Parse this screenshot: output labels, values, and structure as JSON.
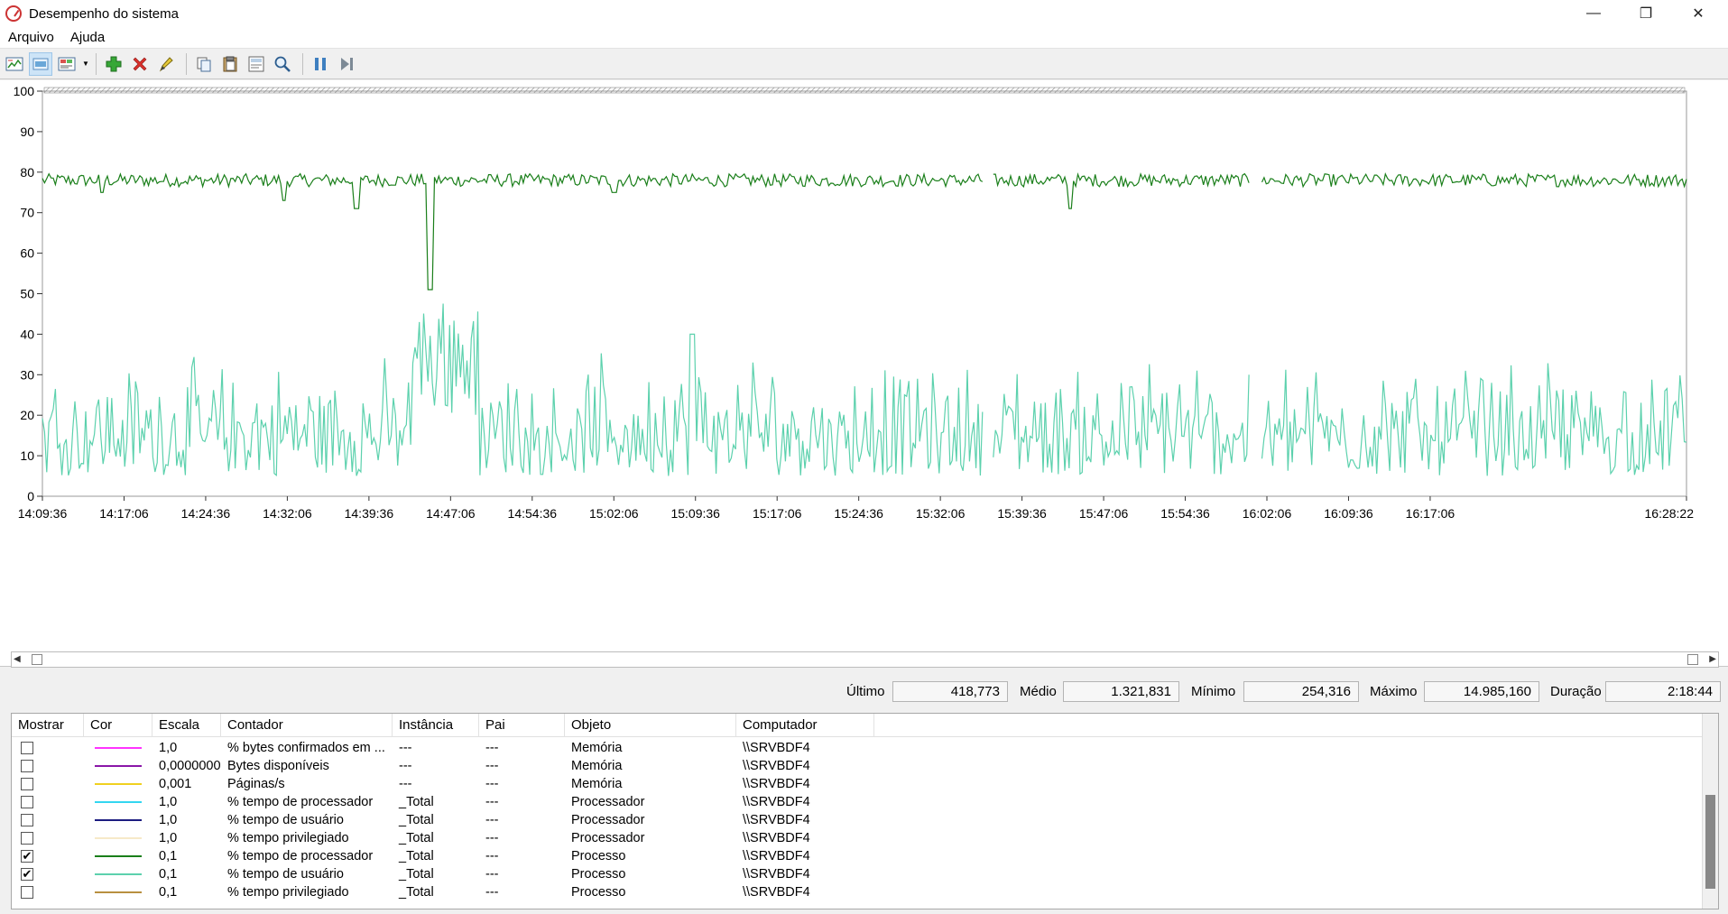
{
  "window": {
    "title": "Desempenho do sistema"
  },
  "title_buttons": {
    "minimize": "—",
    "restore": "❐",
    "close": "✕"
  },
  "menu": [
    "Arquivo",
    "Ajuda"
  ],
  "toolbar_icons": [
    "change-graph-icon",
    "highlight-icon",
    "properties-icon",
    "dropdown-icon",
    "add-counter-icon",
    "delete-counter-icon",
    "highlight-pen-icon",
    "copy-icon",
    "paste-icon",
    "properties-page-icon",
    "zoom-icon",
    "freeze-icon",
    "update-icon"
  ],
  "chart_data": {
    "type": "line",
    "ylim": [
      0,
      100
    ],
    "yticks": [
      0,
      10,
      20,
      30,
      40,
      50,
      60,
      70,
      80,
      90,
      100
    ],
    "x_tick_labels": [
      "14:09:36",
      "14:17:06",
      "14:24:36",
      "14:32:06",
      "14:39:36",
      "14:47:06",
      "14:54:36",
      "15:02:06",
      "15:09:36",
      "15:17:06",
      "15:24:36",
      "15:32:06",
      "15:39:36",
      "15:47:06",
      "15:54:36",
      "16:02:06",
      "16:09:36",
      "16:17:06",
      "16:28:22"
    ],
    "series": [
      {
        "name": "% tempo de processador",
        "color": "#1a7f1a",
        "baseline": 78,
        "amplitude": 1.6,
        "gaps": [
          0.572,
          0.578,
          0.735,
          0.741
        ],
        "dips": [
          [
            0.036,
            75
          ],
          [
            0.147,
            73
          ],
          [
            0.191,
            71
          ],
          [
            0.236,
            51
          ],
          [
            0.347,
            51
          ],
          [
            0.348,
            75
          ],
          [
            0.625,
            71
          ]
        ]
      },
      {
        "name": "% tempo de usuário",
        "color": "#5cd1ad",
        "typical_range": [
          5,
          36
        ],
        "peak_region": [
          0.225,
          0.265
        ],
        "peak_max": 49,
        "secondary_peak": [
          0.395,
          40
        ]
      }
    ]
  },
  "stats": [
    {
      "label": "Último",
      "value": "418,773"
    },
    {
      "label": "Médio",
      "value": "1.321,831"
    },
    {
      "label": "Mínimo",
      "value": "254,316"
    },
    {
      "label": "Máximo",
      "value": "14.985,160"
    },
    {
      "label": "Duração",
      "value": "2:18:44"
    }
  ],
  "table": {
    "columns": [
      "Mostrar",
      "Cor",
      "Escala",
      "Contador",
      "Instância",
      "Pai",
      "Objeto",
      "Computador"
    ],
    "rows": [
      {
        "show": false,
        "color": "#ff33ff",
        "scale": "1,0",
        "counter": "% bytes confirmados em ...",
        "instance": "---",
        "parent": "---",
        "object": "Memória",
        "computer": "\\\\SRVBDF4"
      },
      {
        "show": false,
        "color": "#8a16a8",
        "scale": "0,0000000...",
        "counter": "Bytes disponíveis",
        "instance": "---",
        "parent": "---",
        "object": "Memória",
        "computer": "\\\\SRVBDF4"
      },
      {
        "show": false,
        "color": "#f0d020",
        "scale": "0,001",
        "counter": "Páginas/s",
        "instance": "---",
        "parent": "---",
        "object": "Memória",
        "computer": "\\\\SRVBDF4"
      },
      {
        "show": false,
        "color": "#33d6f0",
        "scale": "1,0",
        "counter": "% tempo de processador",
        "instance": "_Total",
        "parent": "---",
        "object": "Processador",
        "computer": "\\\\SRVBDF4"
      },
      {
        "show": false,
        "color": "#1c1c80",
        "scale": "1,0",
        "counter": "% tempo de usuário",
        "instance": "_Total",
        "parent": "---",
        "object": "Processador",
        "computer": "\\\\SRVBDF4"
      },
      {
        "show": false,
        "color": "#f7e9c8",
        "scale": "1,0",
        "counter": "% tempo privilegiado",
        "instance": "_Total",
        "parent": "---",
        "object": "Processador",
        "computer": "\\\\SRVBDF4"
      },
      {
        "show": true,
        "color": "#1a7f1a",
        "scale": "0,1",
        "counter": "% tempo de processador",
        "instance": "_Total",
        "parent": "---",
        "object": "Processo",
        "computer": "\\\\SRVBDF4"
      },
      {
        "show": true,
        "color": "#5cd1ad",
        "scale": "0,1",
        "counter": "% tempo de usuário",
        "instance": "_Total",
        "parent": "---",
        "object": "Processo",
        "computer": "\\\\SRVBDF4"
      },
      {
        "show": false,
        "color": "#b89040",
        "scale": "0,1",
        "counter": "% tempo privilegiado",
        "instance": "_Total",
        "parent": "---",
        "object": "Processo",
        "computer": "\\\\SRVBDF4"
      }
    ]
  }
}
